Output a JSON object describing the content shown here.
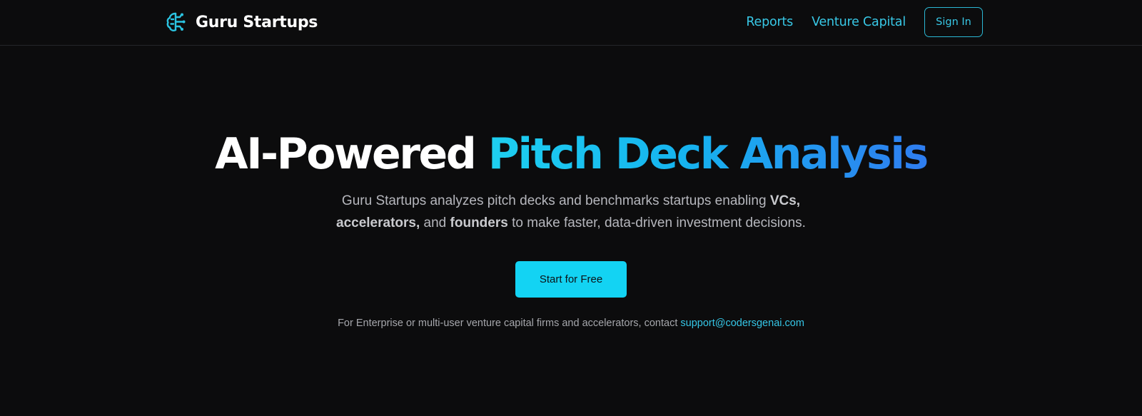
{
  "brand": {
    "name": "Guru Startups",
    "icon": "brain-circuit-icon",
    "icon_color": "#2bc3e0"
  },
  "nav": {
    "links": [
      {
        "label": "Reports"
      },
      {
        "label": "Venture Capital"
      }
    ],
    "signin_label": "Sign In",
    "accent": "#38c8e6"
  },
  "hero": {
    "headline_white": "AI-Powered",
    "headline_gradient": "Pitch Deck Analysis",
    "subtitle": {
      "part1": "Guru Startups analyzes pitch decks and benchmarks startups enabling ",
      "bold1": "VCs,",
      "part2": " ",
      "bold2": "accelerators,",
      "part3": " and ",
      "bold3": "founders",
      "part4": " to make faster, data-driven investment decisions."
    },
    "cta_label": "Start for Free",
    "cta_color": "#13d3f3"
  },
  "contact": {
    "text": "For Enterprise or multi-user venture capital firms and accelerators, contact ",
    "email": "support@codersgenai.com"
  }
}
